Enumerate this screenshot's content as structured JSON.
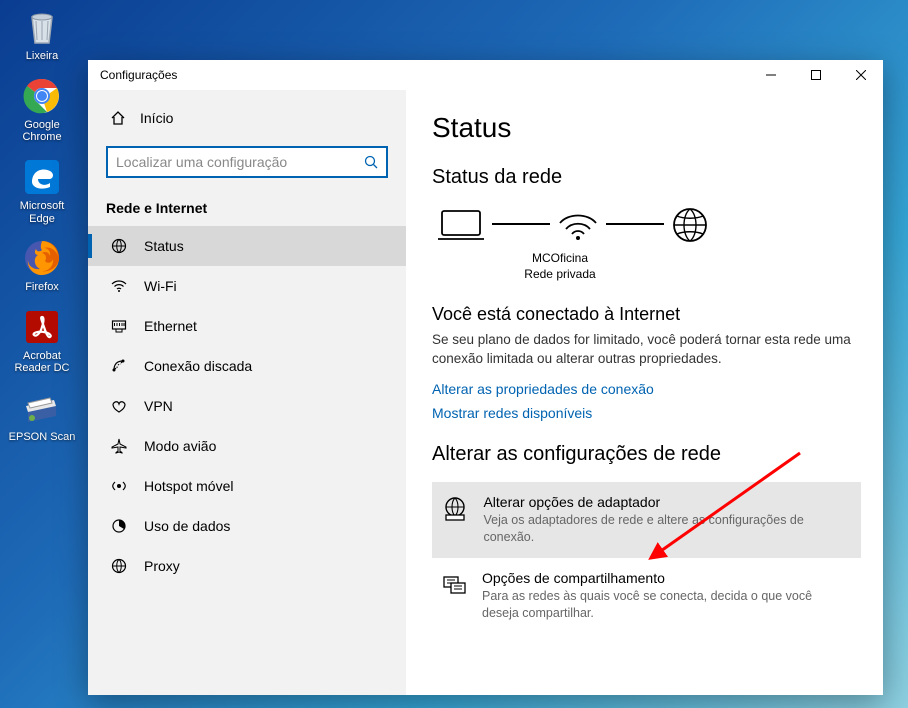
{
  "desktop": {
    "icons": [
      {
        "label": "Lixeira"
      },
      {
        "label": "Google Chrome"
      },
      {
        "label": "Microsoft Edge"
      },
      {
        "label": "Firefox"
      },
      {
        "label": "Acrobat Reader DC"
      },
      {
        "label": "EPSON Scan"
      }
    ]
  },
  "window": {
    "title": "Configurações"
  },
  "sidebar": {
    "home": "Início",
    "search_placeholder": "Localizar uma configuração",
    "group": "Rede e Internet",
    "items": [
      {
        "label": "Status"
      },
      {
        "label": "Wi-Fi"
      },
      {
        "label": "Ethernet"
      },
      {
        "label": "Conexão discada"
      },
      {
        "label": "VPN"
      },
      {
        "label": "Modo avião"
      },
      {
        "label": "Hotspot móvel"
      },
      {
        "label": "Uso de dados"
      },
      {
        "label": "Proxy"
      }
    ]
  },
  "main": {
    "heading": "Status",
    "net_heading": "Status da rede",
    "net_name": "MCOficina",
    "net_type": "Rede privada",
    "connected_heading": "Você está conectado à Internet",
    "connected_desc": "Se seu plano de dados for limitado, você poderá tornar esta rede uma conexão limitada ou alterar outras propriedades.",
    "link_props": "Alterar as propriedades de conexão",
    "link_show": "Mostrar redes disponíveis",
    "change_heading": "Alterar as configurações de rede",
    "opts": [
      {
        "title": "Alterar opções de adaptador",
        "desc": "Veja os adaptadores de rede e altere as configurações de conexão."
      },
      {
        "title": "Opções de compartilhamento",
        "desc": "Para as redes às quais você se conecta, decida o que você deseja compartilhar."
      }
    ]
  }
}
